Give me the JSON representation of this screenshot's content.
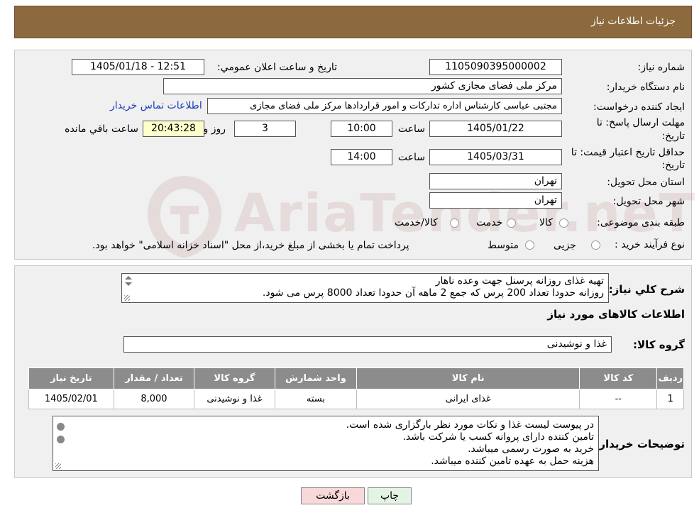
{
  "header": {
    "title": "جزئیات اطلاعات نیاز"
  },
  "watermark": {
    "text": "AriaTender.neT"
  },
  "fields": {
    "need_number_label": "شماره نیاز:",
    "need_number": "1105090395000002",
    "announce_label": "تاریخ و ساعت اعلان عمومي:",
    "announce_value": "1405/01/18 - 12:51",
    "buyer_org_label": "نام دستگاه خریدار:",
    "buyer_org": "مرکز ملی فضای مجازی کشور",
    "creator_label": "ایجاد کننده درخواست:",
    "creator": "مجتبی عباسی کارشناس اداره تدارکات و امور قراردادها مرکز ملی فضای مجازی",
    "contact_link": "اطلاعات تماس خریدار",
    "deadline_label_1": "مهلت ارسال پاسخ: تا",
    "deadline_label_2": "تاریخ:",
    "deadline_date": "1405/01/22",
    "time_label": "ساعت",
    "deadline_time": "10:00",
    "days": "3",
    "days_label": "روز و",
    "remaining_time": "20:43:28",
    "remaining_label": "ساعت باقي مانده",
    "validity_label_1": "حداقل تاریخ اعتبار قیمت: تا",
    "validity_label_2": "تاریخ:",
    "validity_date": "1405/03/31",
    "validity_time_label": "ساعت",
    "validity_time": "14:00",
    "province_label": "استان محل تحویل:",
    "province": "تهران",
    "city_label": "شهر محل تحویل:",
    "city": "تهران",
    "category_label": "طبقه بندی موضوعی:",
    "category_options": [
      "کالا",
      "خدمت",
      "کالا/خدمت"
    ],
    "process_label": "نوع فرآیند خرید :",
    "process_options": [
      "جزیی",
      "متوسط"
    ],
    "process_note": "پرداخت تمام یا بخشی از مبلغ خرید،از محل \"اسناد خزانه اسلامی\" خواهد بود."
  },
  "summary": {
    "label": "شرح كلي نياز:",
    "lines": [
      "تهیه غذای روزانه پرسنل جهت وعده ناهار",
      "روزانه حدودا تعداد 200 پرس که جمع 2 ماهه آن حدودا تعداد 8000 پرس می شود."
    ]
  },
  "goods": {
    "section_title": "اطلاعات کالاهای مورد نیاز",
    "group_label": "گروه کالا:",
    "group_value": "غذا و نوشیدنی",
    "columns": [
      "ردیف",
      "کد کالا",
      "نام کالا",
      "واحد شمارش",
      "گروه کالا",
      "تعداد / مقدار",
      "تاریخ نیاز"
    ],
    "rows": [
      [
        "1",
        "--",
        "غذای ایرانی",
        "بسته",
        "غذا و نوشیدنی",
        "8,000",
        "1405/02/01"
      ]
    ]
  },
  "buyer_notes": {
    "label": "توضیحات خریدار:",
    "lines": [
      "در پیوست لیست غذا و نکات مورد نظر بارگزاری شده است.",
      "تامین کننده دارای پروانه کسب یا شرکت باشد.",
      "خرید به صورت رسمی میباشد.",
      "هزینه حمل به عهده تامین کننده میباشد."
    ]
  },
  "buttons": {
    "print": "چاپ",
    "back": "بازگشت"
  }
}
